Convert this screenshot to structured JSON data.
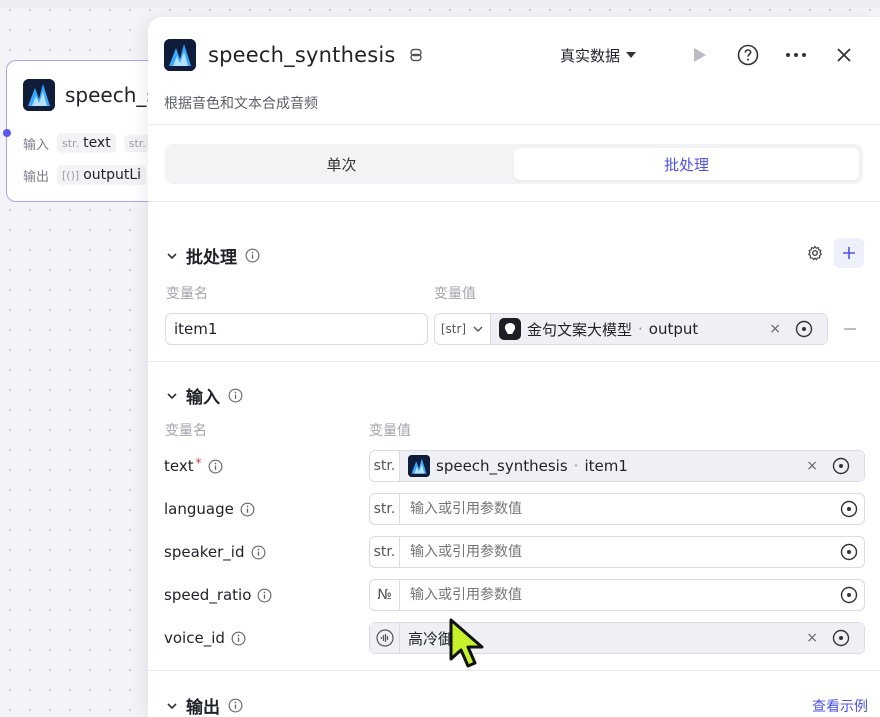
{
  "node": {
    "title": "speech_s",
    "input_label": "输入",
    "output_label": "输出",
    "input_type": "str.",
    "input_name": "text",
    "input_type2": "str.",
    "output_type": "[()]",
    "output_name": "outputLi"
  },
  "panel": {
    "title": "speech_synthesis",
    "description": "根据音色和文本合成音频",
    "data_select": "真实数据"
  },
  "tabs": [
    "单次",
    "批处理"
  ],
  "active_tab": 1,
  "batch": {
    "title": "批处理",
    "col_name": "变量名",
    "col_value": "变量值",
    "item": {
      "name": "item1",
      "type": "[str]",
      "ref_node": "金句文案大模型",
      "ref_sep": "·",
      "ref_field": "output"
    }
  },
  "inputs": {
    "title": "输入",
    "col_name": "变量名",
    "col_value": "变量值",
    "placeholder": "输入或引用参数值",
    "params": [
      {
        "name": "text",
        "required": true,
        "type": "str.",
        "ref_node": "speech_synthesis",
        "ref_sep": "·",
        "ref_field": "item1"
      },
      {
        "name": "language",
        "type": "str."
      },
      {
        "name": "speaker_id",
        "type": "str."
      },
      {
        "name": "speed_ratio",
        "type": "№"
      },
      {
        "name": "voice_id",
        "value": "高冷御"
      }
    ]
  },
  "outputs": {
    "title": "输出",
    "view_example": "查看示例"
  },
  "colors": {
    "accent": "#4d53e8",
    "node_border": "#a9a6f7",
    "required": "#e03c3c"
  }
}
